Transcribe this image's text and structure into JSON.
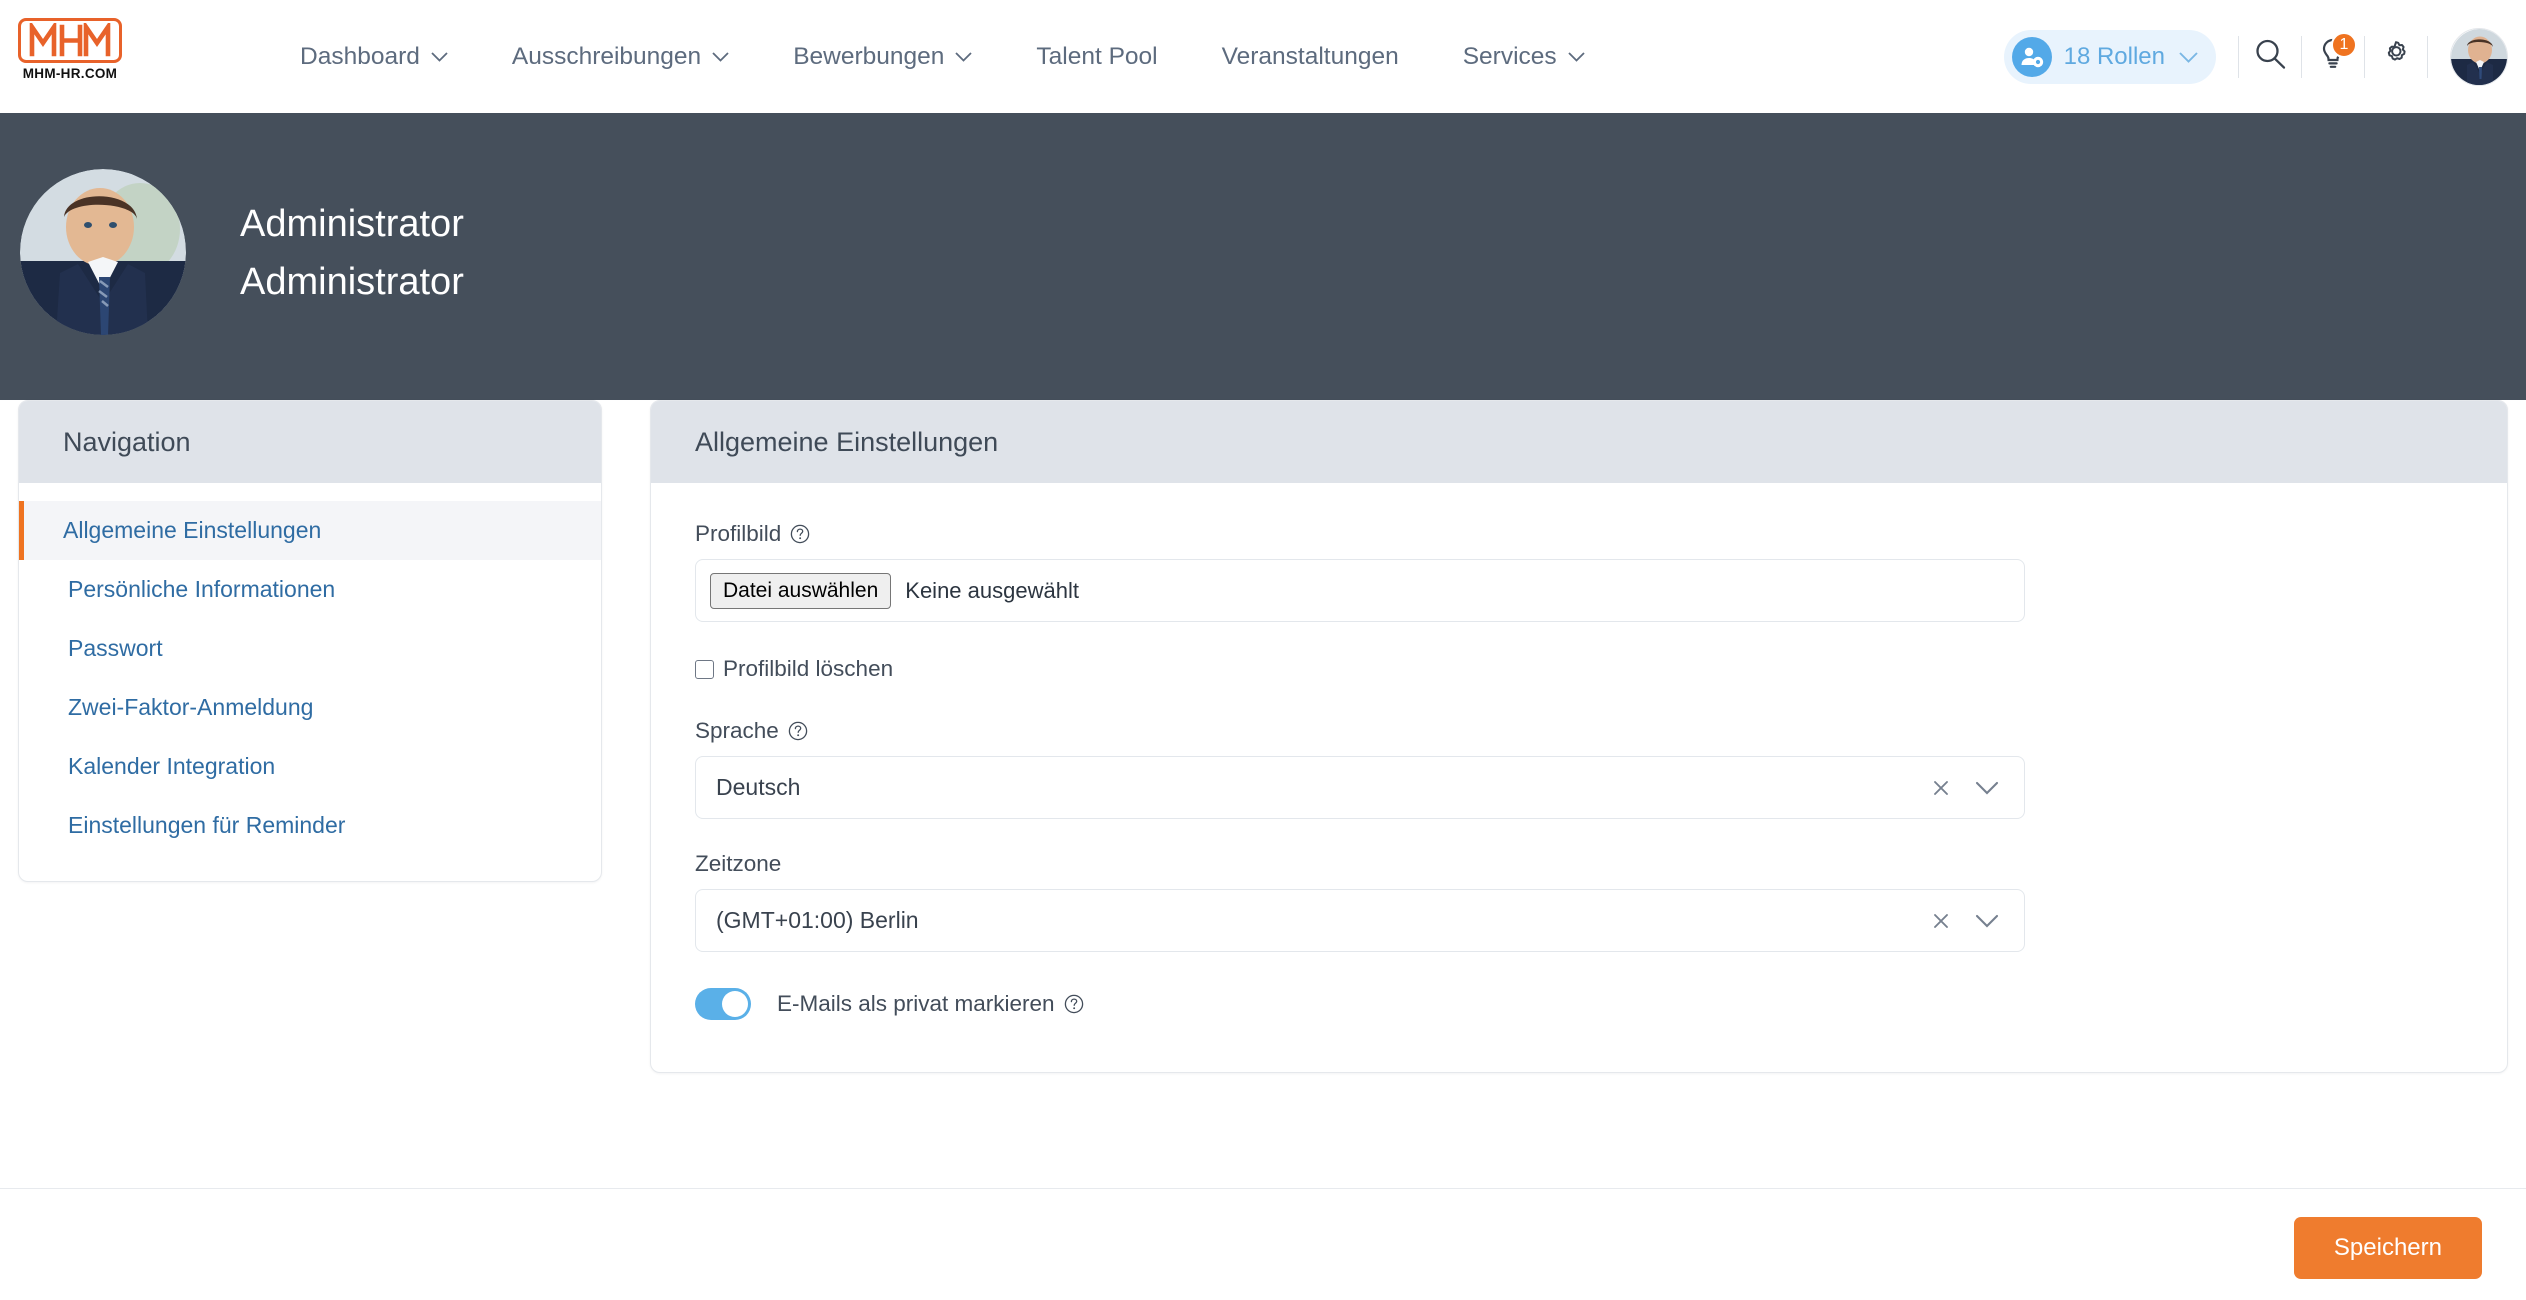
{
  "brand": {
    "logo_text": "MHM",
    "logo_sub": "MHM-HR.COM",
    "logo_color": "#e8622a"
  },
  "header": {
    "nav": [
      {
        "label": "Dashboard",
        "has_dropdown": true
      },
      {
        "label": "Ausschreibungen",
        "has_dropdown": true
      },
      {
        "label": "Bewerbungen",
        "has_dropdown": true
      },
      {
        "label": "Talent Pool",
        "has_dropdown": false
      },
      {
        "label": "Veranstaltungen",
        "has_dropdown": false
      },
      {
        "label": "Services",
        "has_dropdown": true
      }
    ],
    "roles_pill": {
      "label": "18 Rollen",
      "icon": "user-gear-icon",
      "bg": "#e8f3fd",
      "text_color": "#5fa9e0"
    },
    "icons": [
      {
        "name": "search-icon"
      },
      {
        "name": "lightbulb-icon",
        "badge": "1",
        "badge_color": "#ef7320"
      },
      {
        "name": "gear-icon"
      }
    ],
    "avatar": "user-avatar"
  },
  "banner": {
    "first_name": "Administrator",
    "last_name": "Administrator",
    "bg": "#454f5b",
    "avatar": "profile-avatar"
  },
  "sidebar": {
    "title": "Navigation",
    "header_bg": "#dfe3e9",
    "active_accent": "#ef7320",
    "items": [
      {
        "label": "Allgemeine Einstellungen",
        "active": true
      },
      {
        "label": "Persönliche Informationen",
        "active": false
      },
      {
        "label": "Passwort",
        "active": false
      },
      {
        "label": "Zwei-Faktor-Anmeldung",
        "active": false
      },
      {
        "label": "Kalender Integration",
        "active": false
      },
      {
        "label": "Einstellungen für Reminder",
        "active": false
      }
    ]
  },
  "main": {
    "title": "Allgemeine Einstellungen",
    "header_bg": "#dfe3e9",
    "profile_picture": {
      "label": "Profilbild",
      "help_icon": "question-circle-icon",
      "file_button": "Datei auswählen",
      "file_status": "Keine ausgewählt"
    },
    "delete_picture": {
      "label": "Profilbild löschen",
      "checked": false
    },
    "language": {
      "label": "Sprache",
      "help_icon": "question-circle-icon",
      "value": "Deutsch",
      "clear_icon": "close-icon",
      "chevron_icon": "chevron-down-icon"
    },
    "timezone": {
      "label": "Zeitzone",
      "value": "(GMT+01:00) Berlin",
      "clear_icon": "close-icon",
      "chevron_icon": "chevron-down-icon"
    },
    "private_emails": {
      "label": "E-Mails als privat markieren",
      "help_icon": "question-circle-icon",
      "enabled": true,
      "on_color": "#5ab0e8"
    }
  },
  "footer": {
    "save_label": "Speichern",
    "save_color": "#ef7c2e"
  }
}
